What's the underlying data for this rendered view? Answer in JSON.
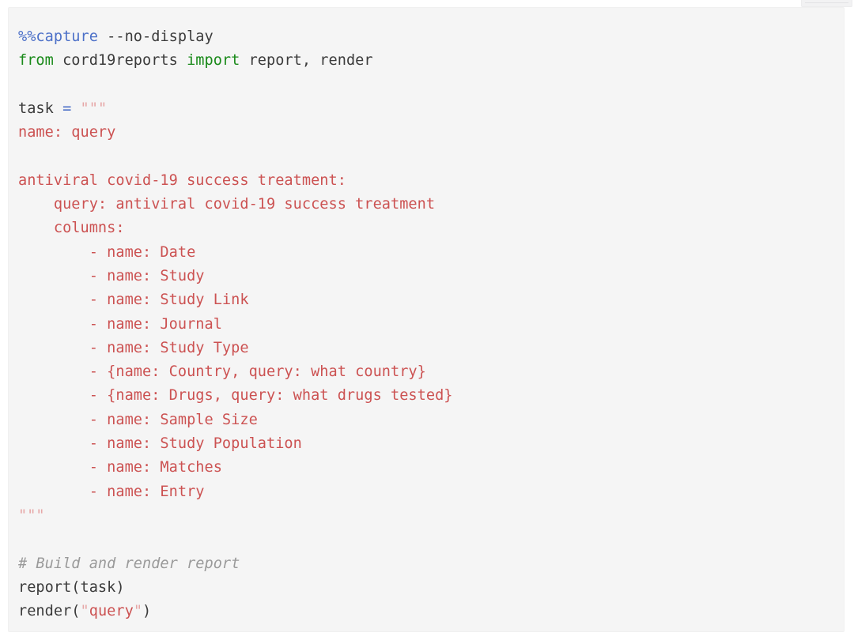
{
  "cell": {
    "type": "jupyter-code-cell",
    "language": "python",
    "background_color": "#f5f5f5",
    "border_color": "#f0f0f0"
  },
  "toolbar_stub": {
    "visible": true,
    "color": "#f2f2f3"
  },
  "colors": {
    "operator": "#4c70c8",
    "magic": "#4c70c8",
    "keyword": "#1a8a1a",
    "plain": "#3b3b3b",
    "string": "#cc5252",
    "string_quote": "#e6a6a6",
    "comment": "#9a9a9a",
    "cell_background": "#f5f5f5",
    "page_background": "#ffffff"
  },
  "code": {
    "line_01_magic": "%%capture",
    "line_01_arg": " --no-display",
    "line_02_from": "from",
    "line_02_module": " cord19reports ",
    "line_02_import": "import",
    "line_02_names": " report, render",
    "line_03_blank": "",
    "line_04_var": "task ",
    "line_04_eq": "=",
    "line_04_quotes": " \"\"\"",
    "line_05": "name: query",
    "line_06_blank": "",
    "line_07": "antiviral covid-19 success treatment:",
    "line_08": "    query: antiviral covid-19 success treatment",
    "line_09": "    columns:",
    "line_10": "        - name: Date",
    "line_11": "        - name: Study",
    "line_12": "        - name: Study Link",
    "line_13": "        - name: Journal",
    "line_14": "        - name: Study Type",
    "line_15": "        - {name: Country, query: what country}",
    "line_16": "        - {name: Drugs, query: what drugs tested}",
    "line_17": "        - name: Sample Size",
    "line_18": "        - name: Study Population",
    "line_19": "        - name: Matches",
    "line_20": "        - name: Entry",
    "line_21_close_quotes": "\"\"\"",
    "line_22_blank": "",
    "line_23_comment": "# Build and render report",
    "line_24": "report(task)",
    "line_25_call": "render(",
    "line_25_q_open": "\"",
    "line_25_arg": "query",
    "line_25_q_close": "\"",
    "line_25_close": ")"
  }
}
